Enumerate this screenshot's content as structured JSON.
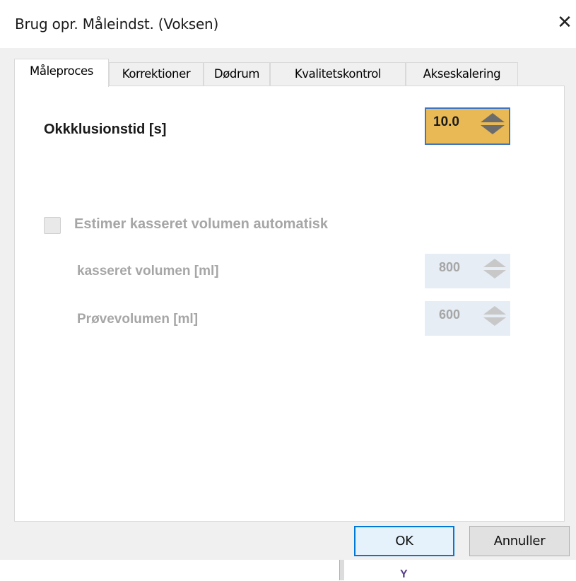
{
  "window": {
    "title": "Brug opr. Måleindst. (Voksen)",
    "close_glyph": "✕"
  },
  "tabs": [
    {
      "label": "Måleproces",
      "active": true
    },
    {
      "label": "Korrektioner",
      "active": false
    },
    {
      "label": "Dødrum",
      "active": false
    },
    {
      "label": "Kvalitetskontrol",
      "active": false
    },
    {
      "label": "Akseskalering",
      "active": false
    }
  ],
  "occlusion": {
    "label": "Okkklusionstid [s]",
    "value": "10.0"
  },
  "estimate": {
    "label": "Estimer kasseret volumen automatisk",
    "checked": false,
    "enabled": false
  },
  "discarded": {
    "label": "kasseret volumen [ml]",
    "value": "800"
  },
  "sample": {
    "label": "Prøvevolumen [ml]",
    "value": "600"
  },
  "buttons": {
    "ok": "OK",
    "cancel": "Annuller"
  },
  "bottom_strip": {
    "mark": "Y"
  },
  "colors": {
    "highlight": "#e8b955",
    "focus_border": "#3d76c4",
    "disabled_text": "#a6a6a6"
  }
}
